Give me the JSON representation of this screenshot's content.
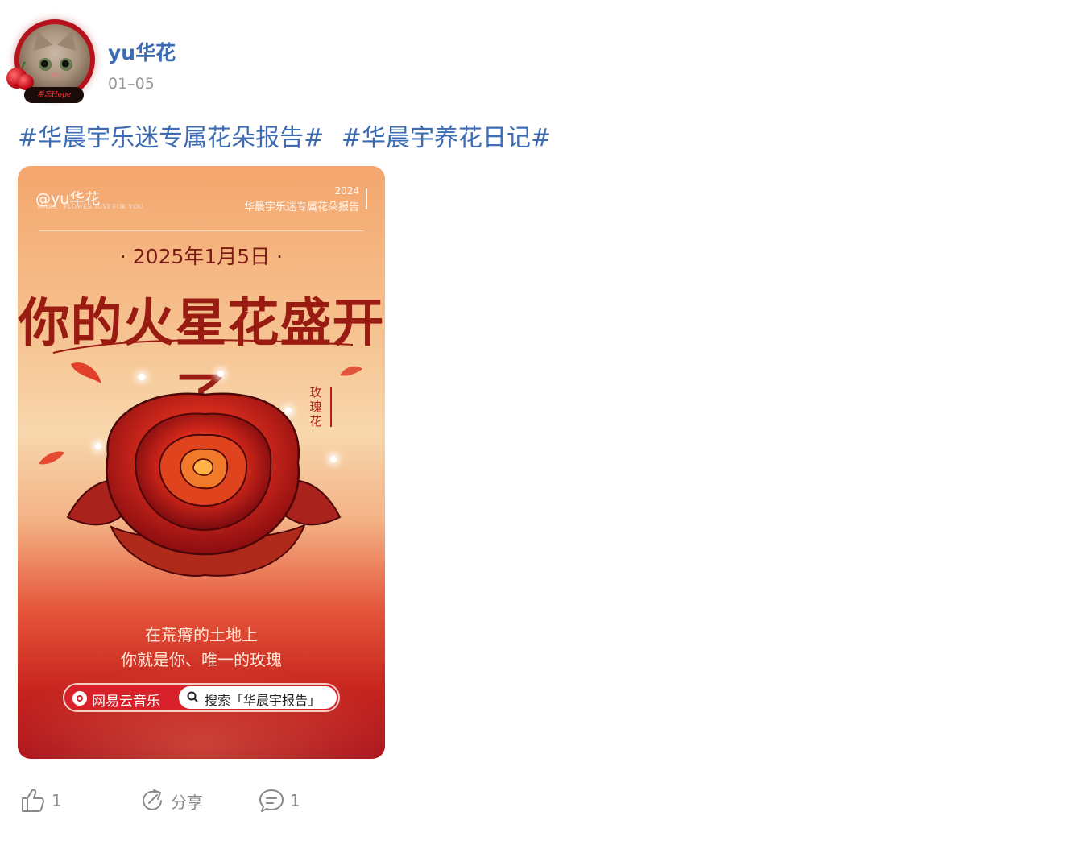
{
  "post": {
    "username": "yu华花",
    "date": "01–05",
    "avatar_badge": "希忘Hope",
    "topics": [
      "#华晨宇乐迷专属花朵报告#",
      "#华晨宇养花日记#"
    ]
  },
  "poster": {
    "handle": "@yu华花",
    "subtitle_en": "MARS · FLOWER JUST FOR YOU",
    "year": "2024",
    "report_title": "华晨宇乐迷专属花朵报告",
    "date": "· 2025年1月5日 ·",
    "headline": "你的火星花盛开了",
    "flower_name": "玫瑰花",
    "line1": "在荒瘠的土地上",
    "line2": "你就是你、唯一的玫瑰",
    "brand": "网易云音乐",
    "search_text": "搜索「华晨宇报告」",
    "colors": {
      "primary": "#d8212a",
      "headline": "#9a1b12"
    }
  },
  "actions": {
    "like": {
      "icon": "thumbs-up-icon",
      "count": "1"
    },
    "share": {
      "icon": "share-icon",
      "label": "分享"
    },
    "comment": {
      "icon": "comment-icon",
      "count": "1"
    }
  },
  "colors": {
    "link": "#3c6cb4",
    "muted": "#999999"
  }
}
